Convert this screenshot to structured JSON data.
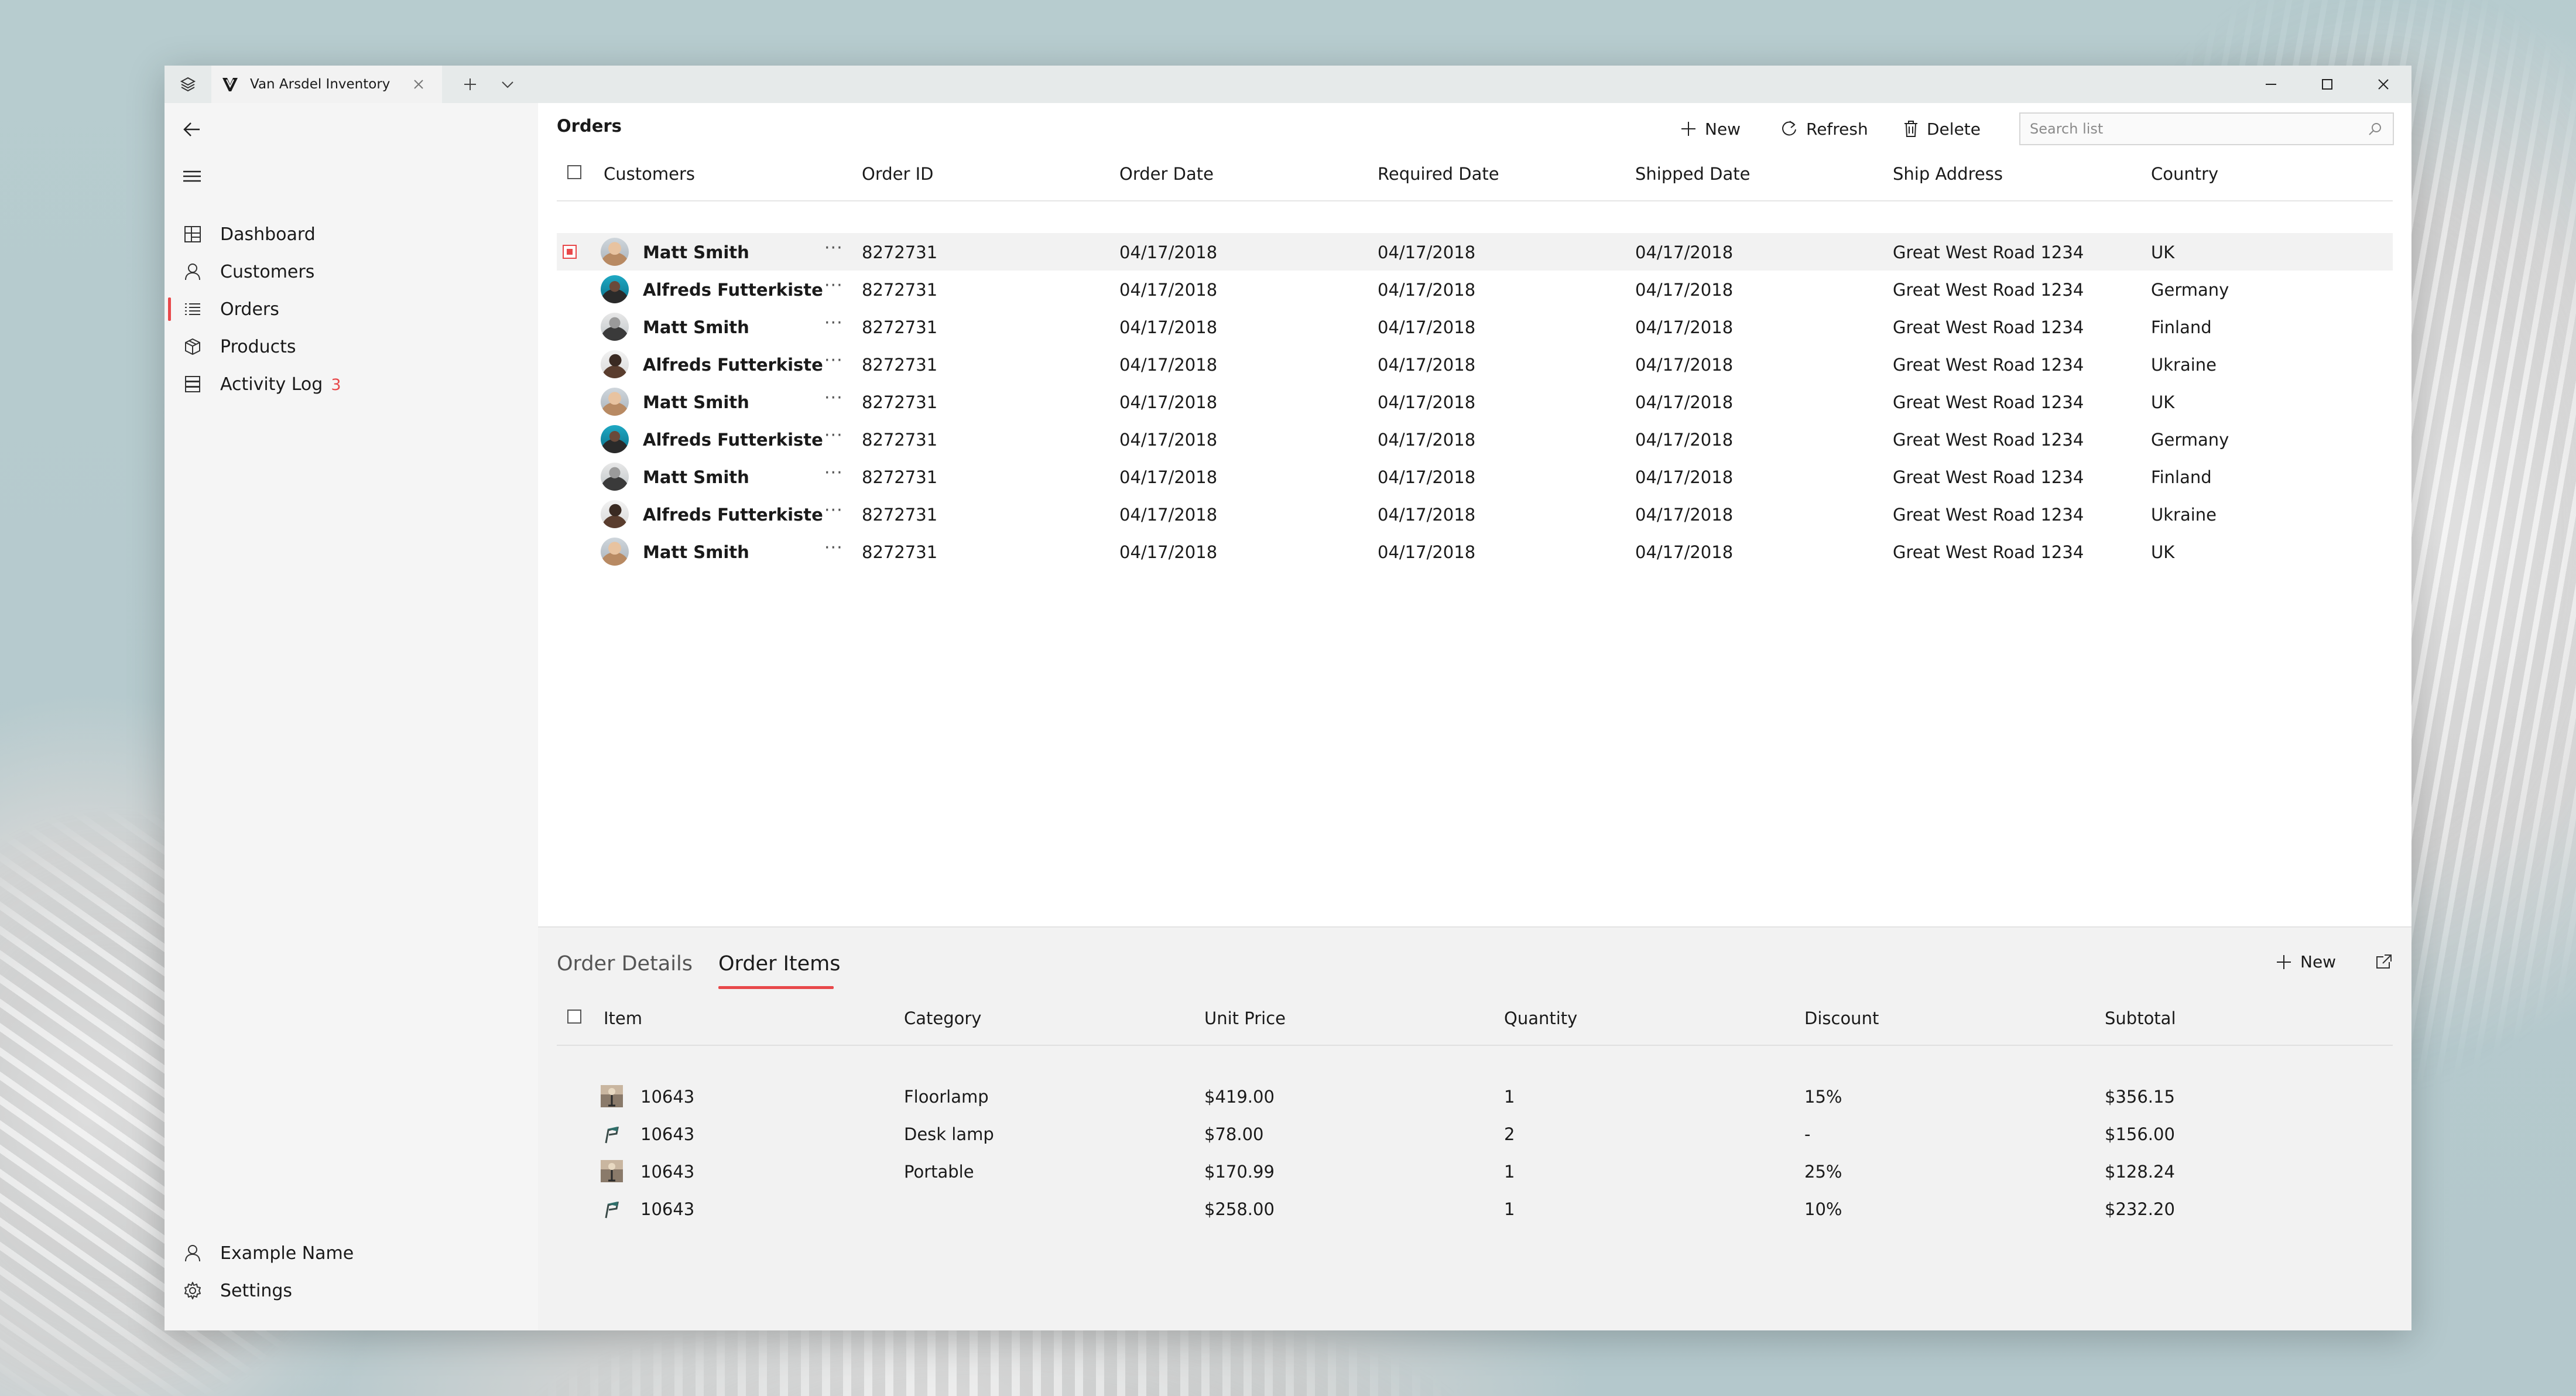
{
  "window": {
    "tab_title": "Van Arsdel Inventory"
  },
  "sidebar": {
    "items": [
      {
        "label": "Dashboard",
        "icon": "dashboard-icon"
      },
      {
        "label": "Customers",
        "icon": "person-icon"
      },
      {
        "label": "Orders",
        "icon": "list-icon",
        "active": true
      },
      {
        "label": "Products",
        "icon": "box-icon"
      },
      {
        "label": "Activity Log",
        "icon": "log-icon",
        "badge": "3"
      }
    ],
    "footer": [
      {
        "label": "Example Name",
        "icon": "person-icon"
      },
      {
        "label": "Settings",
        "icon": "gear-icon"
      }
    ]
  },
  "orders": {
    "title": "Orders",
    "commands": {
      "new": "New",
      "refresh": "Refresh",
      "delete": "Delete"
    },
    "search_placeholder": "Search list",
    "columns": [
      "Customers",
      "Order ID",
      "Order Date",
      "Required Date",
      "Shipped Date",
      "Ship Address",
      "Country"
    ],
    "rows": [
      {
        "customer": "Matt Smith",
        "order_id": "8272731",
        "order_date": "04/17/2018",
        "required_date": "04/17/2018",
        "shipped_date": "04/17/2018",
        "address": "Great West Road 1234",
        "country": "UK",
        "more": "···"
      },
      {
        "customer": "Alfreds Futterkiste",
        "order_id": "8272731",
        "order_date": "04/17/2018",
        "required_date": "04/17/2018",
        "shipped_date": "04/17/2018",
        "address": "Great West Road 1234",
        "country": "Germany",
        "more": "···"
      },
      {
        "customer": "Matt Smith",
        "order_id": "8272731",
        "order_date": "04/17/2018",
        "required_date": "04/17/2018",
        "shipped_date": "04/17/2018",
        "address": "Great West Road 1234",
        "country": "Finland",
        "more": "···"
      },
      {
        "customer": "Alfreds Futterkiste",
        "order_id": "8272731",
        "order_date": "04/17/2018",
        "required_date": "04/17/2018",
        "shipped_date": "04/17/2018",
        "address": "Great West Road 1234",
        "country": "Ukraine",
        "more": "···"
      },
      {
        "customer": "Matt Smith",
        "order_id": "8272731",
        "order_date": "04/17/2018",
        "required_date": "04/17/2018",
        "shipped_date": "04/17/2018",
        "address": "Great West Road 1234",
        "country": "UK",
        "more": "···"
      },
      {
        "customer": "Alfreds Futterkiste",
        "order_id": "8272731",
        "order_date": "04/17/2018",
        "required_date": "04/17/2018",
        "shipped_date": "04/17/2018",
        "address": "Great West Road 1234",
        "country": "Germany",
        "more": "···"
      },
      {
        "customer": "Matt Smith",
        "order_id": "8272731",
        "order_date": "04/17/2018",
        "required_date": "04/17/2018",
        "shipped_date": "04/17/2018",
        "address": "Great West Road 1234",
        "country": "Finland",
        "more": "···"
      },
      {
        "customer": "Alfreds Futterkiste",
        "order_id": "8272731",
        "order_date": "04/17/2018",
        "required_date": "04/17/2018",
        "shipped_date": "04/17/2018",
        "address": "Great West Road 1234",
        "country": "Ukraine",
        "more": "···"
      },
      {
        "customer": "Matt Smith",
        "order_id": "8272731",
        "order_date": "04/17/2018",
        "required_date": "04/17/2018",
        "shipped_date": "04/17/2018",
        "address": "Great West Road 1234",
        "country": "UK",
        "more": "···"
      }
    ]
  },
  "details": {
    "tabs": [
      "Order Details",
      "Order Items"
    ],
    "active_tab": "Order Items",
    "new_label": "New",
    "columns": [
      "Item",
      "Category",
      "Unit Price",
      "Quantity",
      "Discount",
      "Subtotal"
    ],
    "rows": [
      {
        "item": "10643",
        "category": "Floorlamp",
        "unit_price": "$419.00",
        "quantity": "1",
        "discount": "15%",
        "subtotal": "$356.15"
      },
      {
        "item": "10643",
        "category": "Desk lamp",
        "unit_price": "$78.00",
        "quantity": "2",
        "discount": "-",
        "subtotal": "$156.00"
      },
      {
        "item": "10643",
        "category": "Portable",
        "unit_price": "$170.99",
        "quantity": "1",
        "discount": "25%",
        "subtotal": "$128.24"
      },
      {
        "item": "10643",
        "category": "",
        "unit_price": "$258.00",
        "quantity": "1",
        "discount": "10%",
        "subtotal": "$232.20"
      }
    ]
  },
  "colors": {
    "accent": "#e8484a",
    "content_bg": "#ffffff",
    "pane_bg": "#f2f2f2"
  }
}
